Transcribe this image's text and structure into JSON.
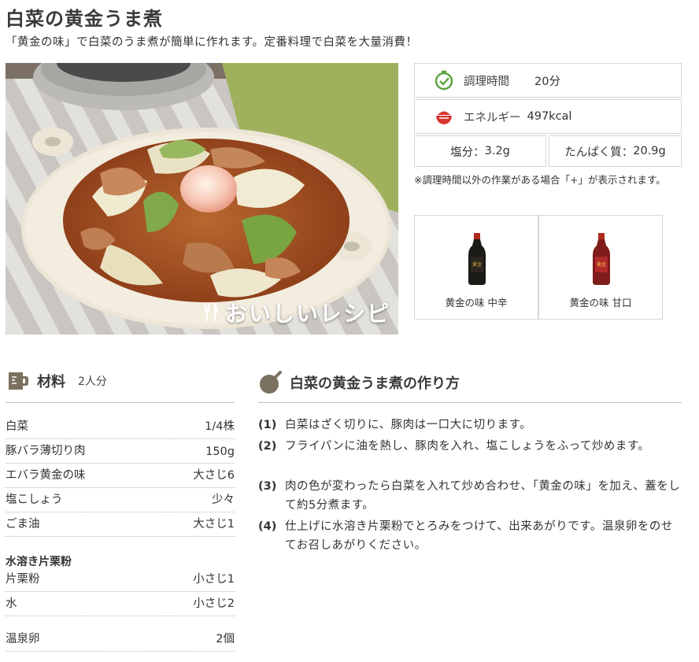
{
  "recipe": {
    "title": "白菜の黄金うま煮",
    "subtitle": "「黄金の味」で白菜のうま煮が簡単に作れます。定番料理で白菜を大量消費！",
    "photo_brand": "おいしいレシピ"
  },
  "info": {
    "time_label": "調理時間",
    "time_value": "20分",
    "energy_label": "エネルギー",
    "energy_value": "497kcal",
    "salt_label": "塩分：",
    "salt_value": "3.2g",
    "protein_label": "たんぱく質：",
    "protein_value": "20.9g",
    "note": "※調理時間以外の作業がある場合「+」が表示されます。"
  },
  "products": [
    {
      "label": "黄金の味 中辛",
      "icon": "sauce-bottle-black-icon"
    },
    {
      "label": "黄金の味 甘口",
      "icon": "sauce-bottle-red-icon"
    }
  ],
  "ingredients": {
    "title": "材料",
    "servings": "2人分",
    "items": [
      {
        "name": "白菜",
        "amount": "1/4株"
      },
      {
        "name": "豚バラ薄切り肉",
        "amount": "150g"
      },
      {
        "name": "エバラ黄金の味",
        "amount": "大さじ6"
      },
      {
        "name": "塩こしょう",
        "amount": "少々"
      },
      {
        "name": "ごま油",
        "amount": "大さじ1"
      }
    ],
    "group_title": "水溶き片栗粉",
    "group_items": [
      {
        "name": "片栗粉",
        "amount": "小さじ1"
      },
      {
        "name": "水",
        "amount": "小さじ2"
      }
    ],
    "extra": [
      {
        "name": "温泉卵",
        "amount": "2個"
      }
    ]
  },
  "steps": {
    "title": "白菜の黄金うま煮の作り方",
    "items": [
      {
        "num": "(1)",
        "text": "白菜はざく切りに、豚肉は一口大に切ります。"
      },
      {
        "num": "(2)",
        "text": "フライパンに油を熱し、豚肉を入れ、塩こしょうをふって炒めます。"
      },
      {
        "num": "(3)",
        "text": "肉の色が変わったら白菜を入れて炒め合わせ、「黄金の味」を加え、蓋をして約5分煮ます。"
      },
      {
        "num": "(4)",
        "text": "仕上げに水溶き片栗粉でとろみをつけて、出来あがりです。温泉卵をのせてお召しあがりください。"
      }
    ]
  },
  "colors": {
    "accent_brown": "#7a7160",
    "timer_green": "#5aa13a",
    "bowl_red": "#d9342b"
  }
}
